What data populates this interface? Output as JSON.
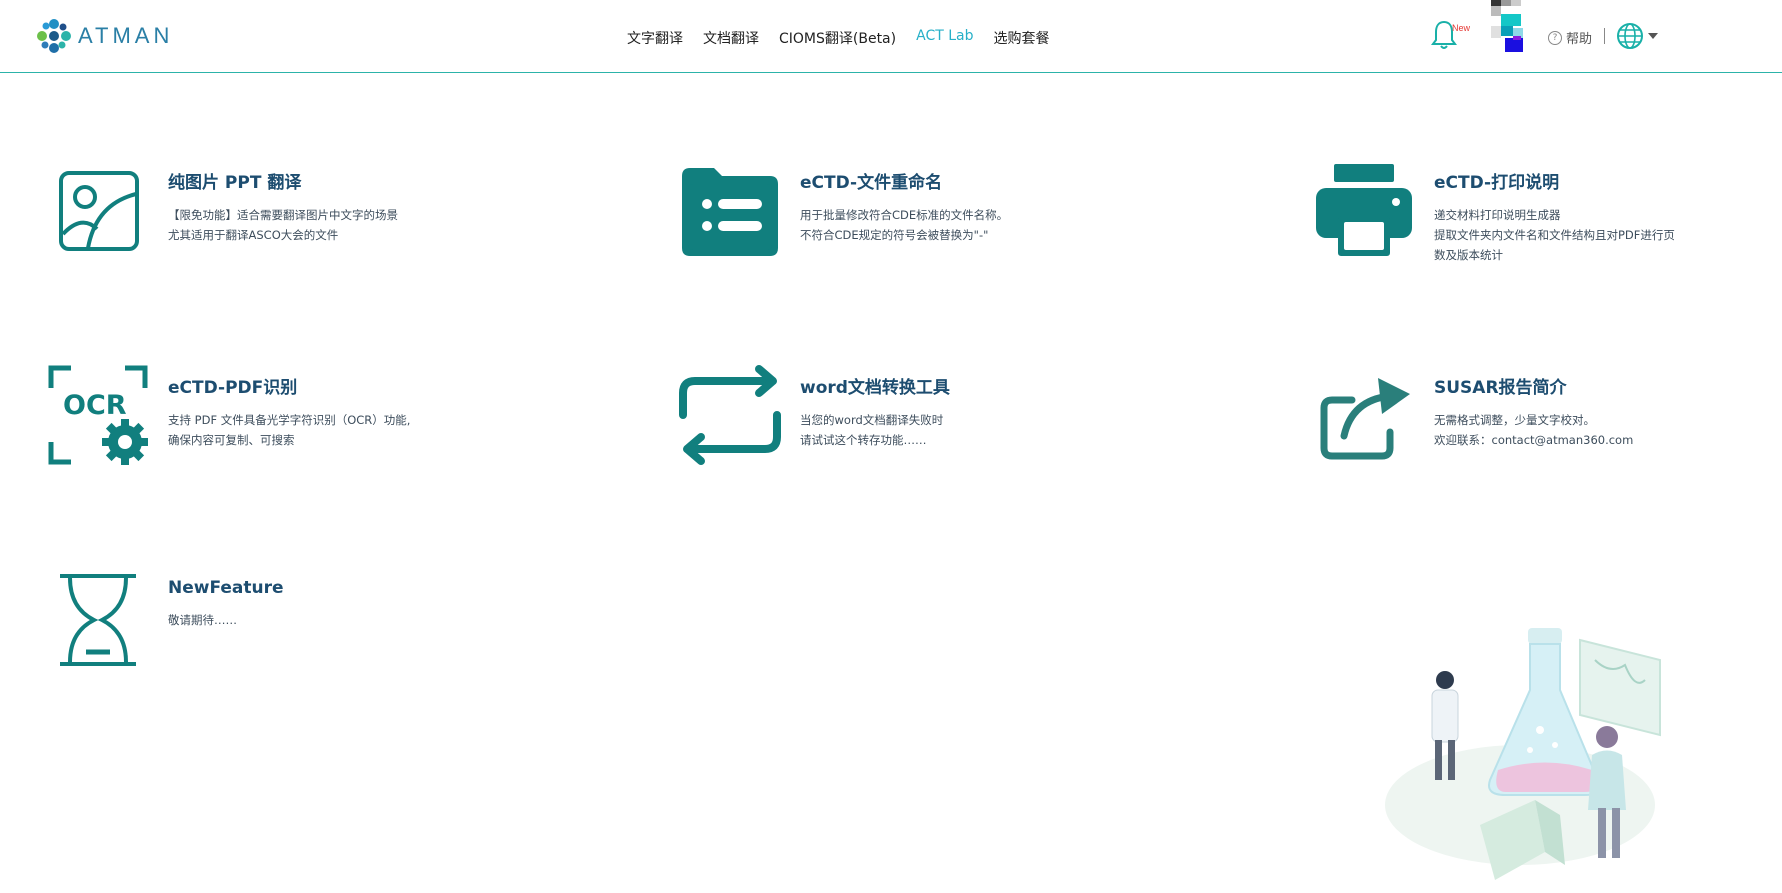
{
  "brand": {
    "name": "ATMAN",
    "accent": "#2cb3a9",
    "title_color": "#1d4d70",
    "icon_color": "#117f7e"
  },
  "nav": [
    {
      "label": "文字翻译",
      "active": false
    },
    {
      "label": "文档翻译",
      "active": false
    },
    {
      "label": "CIOMS翻译(Beta)",
      "active": false
    },
    {
      "label": "ACT Lab",
      "active": true
    },
    {
      "label": "选购套餐",
      "active": false
    }
  ],
  "header": {
    "notification_icon": "bell-icon",
    "new_badge": "New",
    "help_label": "帮助",
    "help_icon": "question-circle-icon",
    "language_icon": "globe-icon"
  },
  "cards": [
    {
      "title": "纯图片 PPT 翻译",
      "icon": "image-icon",
      "desc": [
        "【限免功能】适合需要翻译图片中文字的场景",
        "尤其适用于翻译ASCO大会的文件"
      ]
    },
    {
      "title": "eCTD-文件重命名",
      "icon": "folder-list-icon",
      "desc": [
        "用于批量修改符合CDE标准的文件名称。",
        "不符合CDE规定的符号会被替换为\"-\""
      ]
    },
    {
      "title": "eCTD-打印说明",
      "icon": "printer-icon",
      "desc": [
        "递交材料打印说明生成器",
        "提取文件夹内文件名和文件结构且对PDF进行页数及版本统计"
      ]
    },
    {
      "title": "eCTD-PDF识别",
      "icon": "ocr-icon",
      "ocr_text": "OCR",
      "desc": [
        "支持 PDF 文件具备光学字符识别（OCR）功能,",
        "确保内容可复制、可搜索"
      ]
    },
    {
      "title": "word文档转换工具",
      "icon": "repeat-arrows-icon",
      "desc": [
        "当您的word文档翻译失败时",
        "请试试这个转存功能……"
      ]
    },
    {
      "title": "SUSAR报告简介",
      "icon": "share-arrow-icon",
      "desc": [
        "无需格式调整，少量文字校对。",
        "欢迎联系：contact@atman360.com"
      ]
    },
    {
      "title": "NewFeature",
      "icon": "hourglass-icon",
      "desc": [
        "敬请期待……"
      ]
    }
  ]
}
